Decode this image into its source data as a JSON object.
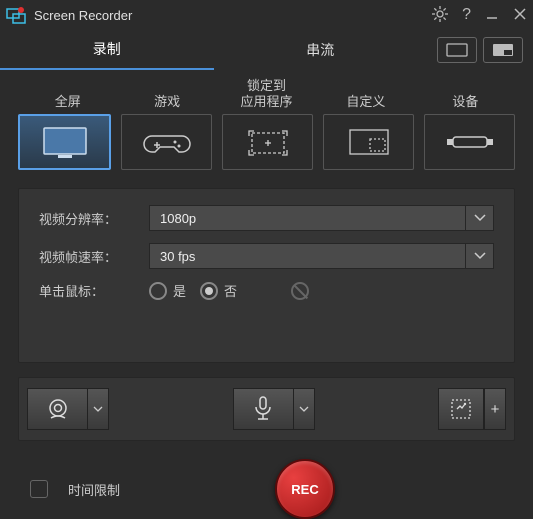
{
  "title": "Screen Recorder",
  "tabs": {
    "record": "录制",
    "stream": "串流"
  },
  "sources": {
    "fullscreen": "全屏",
    "game": "游戏",
    "lock_to": "锁定到",
    "app": "应用程序",
    "custom": "自定义",
    "device": "设备"
  },
  "settings": {
    "resolution_label": "视频分辨率：",
    "resolution_value": "1080p",
    "fps_label": "视频帧速率：",
    "fps_value": "30 fps",
    "click_label": "单击鼠标：",
    "yes": "是",
    "no": "否"
  },
  "time_limit": "时间限制",
  "rec": "REC",
  "colors": {
    "accent": "#4a90d9",
    "rec": "#c92020"
  }
}
